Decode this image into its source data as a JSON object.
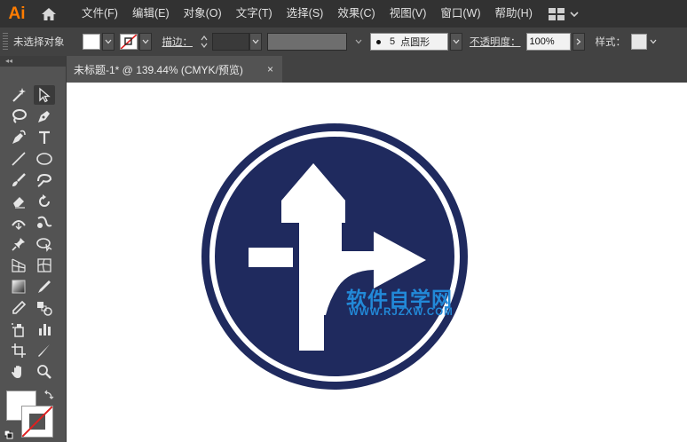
{
  "app": {
    "logo": "Ai"
  },
  "menu": [
    "文件(F)",
    "编辑(E)",
    "对象(O)",
    "文字(T)",
    "选择(S)",
    "效果(C)",
    "视图(V)",
    "窗口(W)",
    "帮助(H)"
  ],
  "control": {
    "selection_status": "未选择对象",
    "stroke_label": "描边：",
    "brush_size": "5",
    "brush_name": "点圆形",
    "opacity_label": "不透明度：",
    "opacity_value": "100%",
    "style_label": "样式："
  },
  "document": {
    "tab_title": "未标题-1* @ 139.44% (CMYK/预览)",
    "close_glyph": "×"
  },
  "artwork": {
    "sign_color": "#1f2a5e",
    "watermark_text": "软件自学网",
    "watermark_url": "WWW.RJZXW.COM",
    "watermark_color": "#2289d8"
  },
  "icons": [
    "home-icon",
    "workspace-grid-icon",
    "selection-tool-icon",
    "direct-selection-tool-icon",
    "pen-tool-icon",
    "type-tool-icon",
    "hand-tool-icon",
    "zoom-tool-icon"
  ]
}
